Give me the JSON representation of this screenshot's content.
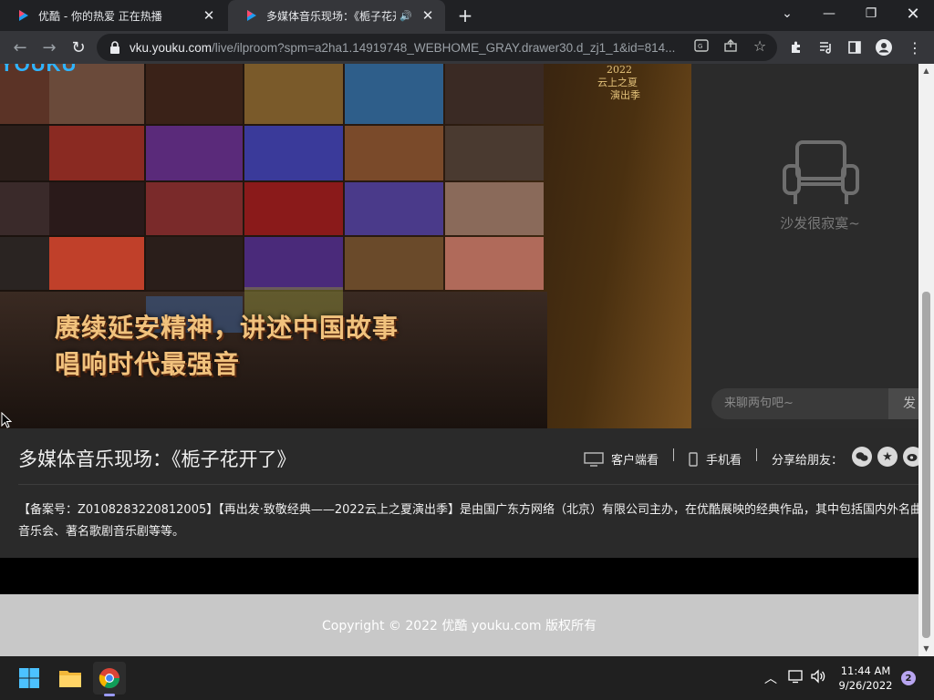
{
  "browser": {
    "tabs": [
      {
        "title": "优酷 - 你的热爱 正在热播",
        "active": false
      },
      {
        "title": "多媒体音乐现场：《栀子花开了",
        "active": true,
        "audio_playing": true
      }
    ],
    "url": {
      "host": "vku.youku.com",
      "path": "/live/ilproom?spm=a2ha1.14919748_WEBHOME_GRAY.drawer30.d_zj1_1&id=814..."
    }
  },
  "player": {
    "logo_fragment": "YOUKU",
    "slogan_line1": "赓续延安精神，讲述中国故事",
    "slogan_line2": "唱响时代最强音",
    "badge_year": "2022",
    "badge_line1": "云上之夏",
    "badge_line2": "演出季"
  },
  "chat": {
    "empty_text": "沙发很寂寞~",
    "input_placeholder": "来聊两句吧~",
    "send_label": "发"
  },
  "room": {
    "title": "多媒体音乐现场：《栀子花开了》",
    "watch_client": "客户端看",
    "watch_mobile": "手机看",
    "share_label": "分享给朋友：",
    "description": "【备案号：Z0108283220812005】【再出发·致敬经典——2022云上之夏演出季】是由国广东方网络（北京）有限公司主办，在优酷展映的经典作品，其中包括国内外名曲音乐会、著名歌剧音乐剧等等。"
  },
  "footer": {
    "copyright": "Copyright © 2022 优酷 youku.com 版权所有"
  },
  "taskbar": {
    "time": "11:44 AM",
    "date": "9/26/2022",
    "notification_count": "2"
  },
  "colors": {
    "accent_youku": "#2fb4ff",
    "slogan_gold": "#f1c27d"
  }
}
